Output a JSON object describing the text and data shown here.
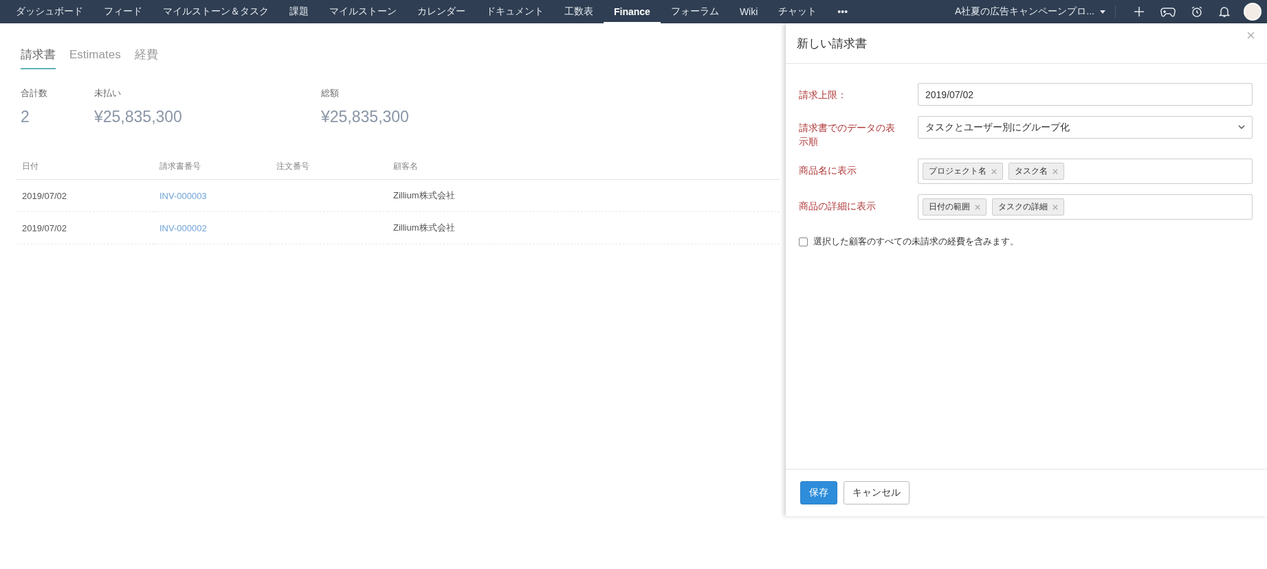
{
  "nav": {
    "items": [
      {
        "label": "ダッシュボード",
        "selected": false
      },
      {
        "label": "フィード",
        "selected": false
      },
      {
        "label": "マイルストーン＆タスク",
        "selected": false
      },
      {
        "label": "課題",
        "selected": false
      },
      {
        "label": "マイルストーン",
        "selected": false
      },
      {
        "label": "カレンダー",
        "selected": false
      },
      {
        "label": "ドキュメント",
        "selected": false
      },
      {
        "label": "工数表",
        "selected": false
      },
      {
        "label": "Finance",
        "selected": true
      },
      {
        "label": "フォーラム",
        "selected": false
      },
      {
        "label": "Wiki",
        "selected": false
      },
      {
        "label": "チャット",
        "selected": false
      },
      {
        "label": "•••",
        "selected": false
      }
    ],
    "project": "A社夏の広告キャンペーンプロ..."
  },
  "tabs": [
    {
      "label": "請求書",
      "selected": true
    },
    {
      "label": "Estimates",
      "selected": false
    },
    {
      "label": "経費",
      "selected": false
    }
  ],
  "stats": [
    {
      "label": "合計数",
      "value": "2"
    },
    {
      "label": "未払い",
      "value": "¥25,835,300"
    },
    {
      "label": "総額",
      "value": "¥25,835,300"
    }
  ],
  "table": {
    "columns": [
      "日付",
      "請求書番号",
      "注文番号",
      "顧客名"
    ],
    "rows": [
      {
        "date": "2019/07/02",
        "invoice": "INV-000003",
        "customer": "Zillium株式会社"
      },
      {
        "date": "2019/07/02",
        "invoice": "INV-000002",
        "customer": "Zillium株式会社"
      }
    ]
  },
  "panel": {
    "title": "新しい請求書",
    "fields": [
      {
        "kind": "text",
        "label": "請求上限：",
        "value": "2019/07/02"
      },
      {
        "kind": "select",
        "label": "請求書でのデータの表示順",
        "value": "タスクとユーザー別にグループ化"
      },
      {
        "kind": "tags",
        "label": "商品名に表示",
        "tags": [
          "プロジェクト名",
          "タスク名"
        ]
      },
      {
        "kind": "tags",
        "label": "商品の詳細に表示",
        "tags": [
          "日付の範囲",
          "タスクの詳細"
        ]
      }
    ],
    "checkbox": {
      "label": "選択した顧客のすべての未請求の経費を含みます。",
      "checked": false
    },
    "buttons": [
      {
        "kind": "primary",
        "label": "保存"
      },
      {
        "kind": "secondary",
        "label": "キャンセル"
      }
    ]
  }
}
